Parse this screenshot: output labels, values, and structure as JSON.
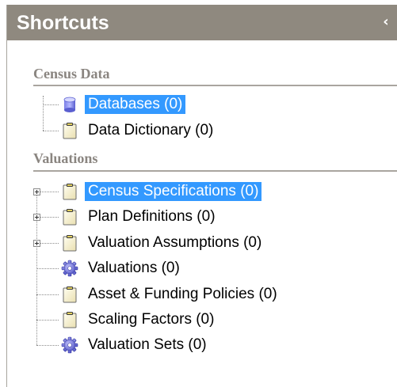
{
  "header": {
    "title": "Shortcuts",
    "collapse_glyph": "‹"
  },
  "sections": [
    {
      "title": "Census Data",
      "items": [
        {
          "label": "Databases (0)",
          "icon": "database-icon",
          "selected": true
        },
        {
          "label": "Data Dictionary (0)",
          "icon": "clipboard-icon",
          "selected": false
        }
      ]
    },
    {
      "title": "Valuations",
      "items": [
        {
          "label": "Census Specifications (0)",
          "icon": "clipboard-icon",
          "expandable": true,
          "selected": true
        },
        {
          "label": "Plan Definitions (0)",
          "icon": "clipboard-icon",
          "expandable": true,
          "selected": false
        },
        {
          "label": "Valuation Assumptions (0)",
          "icon": "clipboard-icon",
          "expandable": true,
          "selected": false
        },
        {
          "label": "Valuations (0)",
          "icon": "gear-icon",
          "selected": false
        },
        {
          "label": "Asset & Funding Policies (0)",
          "icon": "clipboard-icon",
          "selected": false
        },
        {
          "label": "Scaling Factors (0)",
          "icon": "clipboard-icon",
          "selected": false
        },
        {
          "label": "Valuation Sets (0)",
          "icon": "gear-icon",
          "selected": false
        }
      ]
    }
  ],
  "colors": {
    "header_bg": "#8f897f",
    "selection_bg": "#3399ff",
    "section_title": "#8a8580"
  }
}
